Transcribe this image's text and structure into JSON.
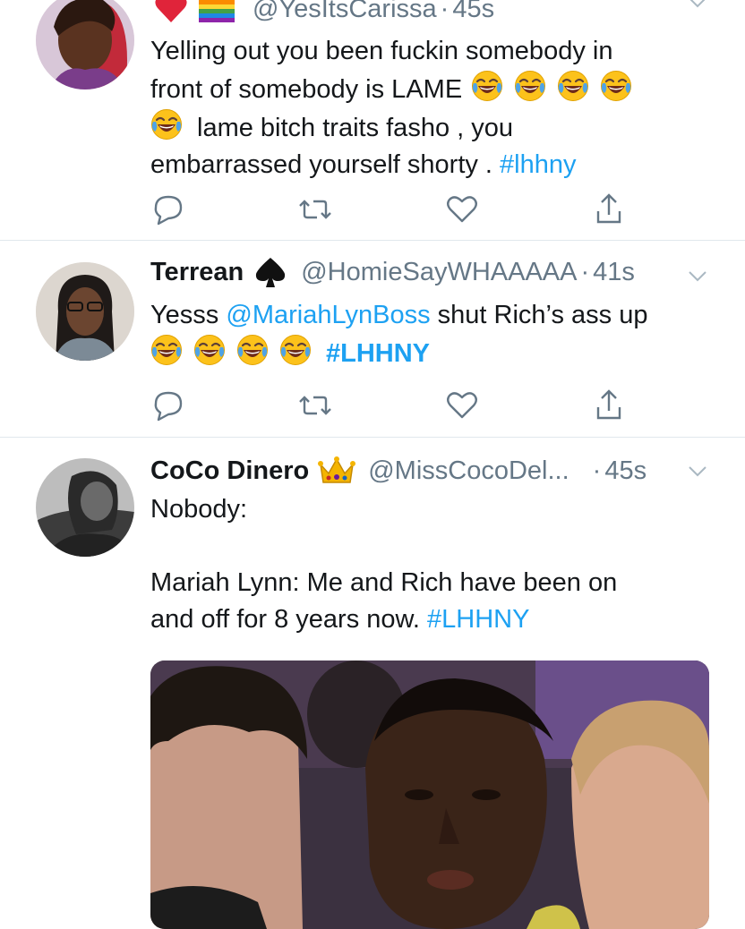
{
  "tweets": [
    {
      "handle": "@YesItsCarissa",
      "sep": "·",
      "time": "45s",
      "text1": "Yelling out you been fuckin somebody in",
      "text2": "front of somebody is LAME",
      "text3": "lame bitch traits fasho , you",
      "text4": "embarrassed yourself shorty .",
      "hashtag": "#lhhny"
    },
    {
      "name": "Terrean",
      "handle": "@HomieSayWHAAAAA",
      "sep": "·",
      "time": "41s",
      "text_before": "Yesss",
      "mention": "@MariahLynBoss",
      "text_after": "shut Rich’s ass up",
      "hashtag": "#LHHNY"
    },
    {
      "name": "CoCo Dinero",
      "handle": "@MissCocoDel...",
      "sep": "·",
      "time": "45s",
      "text1": "Nobody:",
      "text2": "Mariah Lynn: Me and Rich have been on",
      "text3": "and off for 8 years now.",
      "hashtag": "#LHHNY"
    }
  ],
  "icons": {
    "reply": "reply-icon",
    "retweet": "retweet-icon",
    "like": "heart-icon",
    "share": "share-icon",
    "more": "chevron-down-icon"
  },
  "colors": {
    "link": "#1da1f2",
    "secondary": "#657786",
    "divider": "#e1e8ed"
  }
}
